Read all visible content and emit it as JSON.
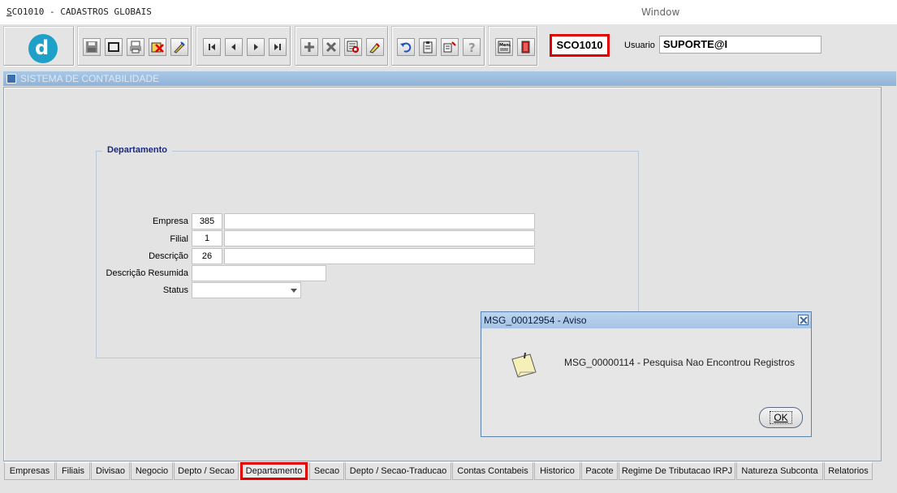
{
  "window": {
    "title": "SCO1010 - CADASTROS GLOBAIS",
    "menu_window": "Window"
  },
  "toolbar": {
    "form_code": "SCO1010",
    "user_label": "Usuario",
    "user_value": "SUPORTE@I",
    "icons": [
      "save-icon",
      "print-preview-icon",
      "print-icon",
      "delete-record-icon",
      "edit-icon",
      "first-record-icon",
      "previous-record-icon",
      "next-record-icon",
      "last-record-icon",
      "insert-record-icon",
      "remove-record-icon",
      "query-icon",
      "clear-icon",
      "undo-icon",
      "clipboard-icon",
      "list-values-icon",
      "help-icon",
      "menu-icon",
      "exit-icon"
    ]
  },
  "system_bar": {
    "title": "SISTEMA DE CONTABILIDADE"
  },
  "form": {
    "section_title": "Departamento",
    "fields": {
      "empresa": {
        "label": "Empresa",
        "code": "385",
        "description": ""
      },
      "filial": {
        "label": "Filial",
        "code": "1",
        "description": ""
      },
      "descricao": {
        "label": "Descrição",
        "code": "26",
        "description": ""
      },
      "descricao_resumida": {
        "label": "Descrição Resumida",
        "value": ""
      },
      "status": {
        "label": "Status",
        "value": ""
      }
    }
  },
  "dialog": {
    "title": "MSG_00012954 - Aviso",
    "message": "MSG_00000114 - Pesquisa Nao Encontrou Registros",
    "ok_label": "OK"
  },
  "tabs": [
    "Empresas",
    "Filiais",
    "Divisao",
    "Negocio",
    "Depto / Secao",
    "Departamento",
    "Secao",
    "Depto / Secao-Traducao",
    "Contas Contabeis",
    "Historico",
    "Pacote",
    "Regime De Tributacao IRPJ",
    "Natureza Subconta",
    "Relatorios"
  ],
  "active_tab": "Departamento",
  "colors": {
    "highlight": "#e00000",
    "logo": "#1ea0c8",
    "section_title": "#1a2a80"
  }
}
